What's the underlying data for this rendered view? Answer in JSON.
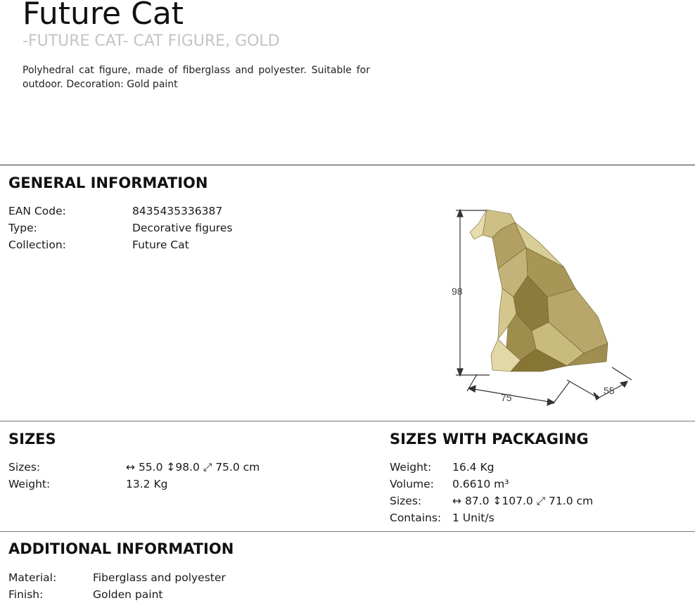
{
  "product": {
    "title": "Future Cat",
    "subtitle": "-FUTURE CAT- CAT FIGURE, GOLD",
    "description": "Polyhedral cat figure, made of fiberglass and polyester. Suitable for outdoor. Decoration: Gold paint"
  },
  "general": {
    "heading": "GENERAL INFORMATION",
    "rows": [
      {
        "label": "EAN Code:",
        "value": "8435435336387"
      },
      {
        "label": "Type:",
        "value": "Decorative figures"
      },
      {
        "label": "Collection:",
        "value": "Future Cat"
      }
    ]
  },
  "figure": {
    "height_label": "98",
    "width_label": "75",
    "depth_label": "55",
    "gold_color": "#b6a46a"
  },
  "sizes": {
    "heading": "SIZES",
    "sizes_label": "Sizes:",
    "width": "55.0",
    "height": "98.0",
    "depth": "75.0",
    "unit": "cm",
    "weight_label": "Weight:",
    "weight_value": "13.2 Kg"
  },
  "packaging": {
    "heading": "SIZES WITH PACKAGING",
    "weight_label": "Weight:",
    "weight_value": "16.4 Kg",
    "volume_label": "Volume:",
    "volume_value": "0.6610 m³",
    "sizes_label": "Sizes:",
    "width": "87.0",
    "height": "107.0",
    "depth": "71.0",
    "unit": "cm",
    "contains_label": "Contains:",
    "contains_value": "1 Unit/s"
  },
  "additional": {
    "heading": "ADDITIONAL INFORMATION",
    "rows": [
      {
        "label": "Material:",
        "value": "Fiberglass and polyester"
      },
      {
        "label": "Finish:",
        "value": "Golden paint"
      }
    ]
  },
  "icons": {
    "width_icon": "↔",
    "height_icon": "↕",
    "depth_icon": "⤢"
  }
}
